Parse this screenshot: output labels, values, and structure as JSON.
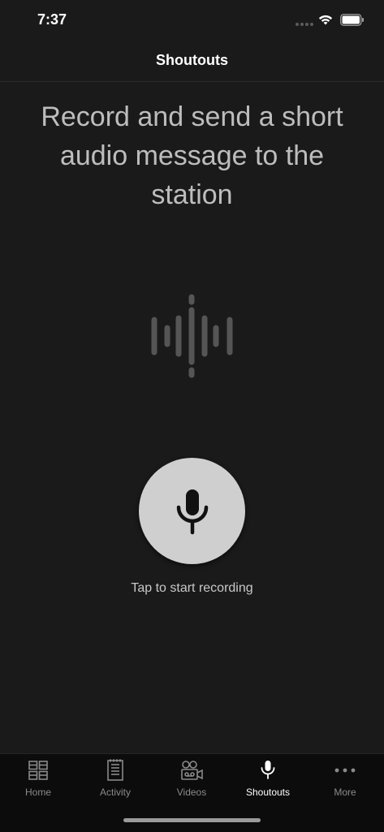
{
  "status_bar": {
    "time": "7:37"
  },
  "header": {
    "title": "Shoutouts"
  },
  "main": {
    "headline": "Record and send a short audio message to the station",
    "record_hint": "Tap to start recording",
    "mic_button_icon": "microphone-icon",
    "waveform_icon": "audio-waveform-icon"
  },
  "tab_bar": {
    "tabs": [
      {
        "label": "Home",
        "icon": "grid-icon",
        "active": false
      },
      {
        "label": "Activity",
        "icon": "document-list-icon",
        "active": false
      },
      {
        "label": "Videos",
        "icon": "video-camera-icon",
        "active": false
      },
      {
        "label": "Shoutouts",
        "icon": "microphone-icon",
        "active": true
      },
      {
        "label": "More",
        "icon": "ellipsis-icon",
        "active": false
      }
    ]
  },
  "colors": {
    "background": "#1a1a1a",
    "tab_bar_background": "#0c0c0c",
    "mic_button": "#cfcfcf",
    "headline_text": "#bdbdbd",
    "inactive_tab": "#8a8a8a",
    "active_tab": "#ffffff"
  }
}
